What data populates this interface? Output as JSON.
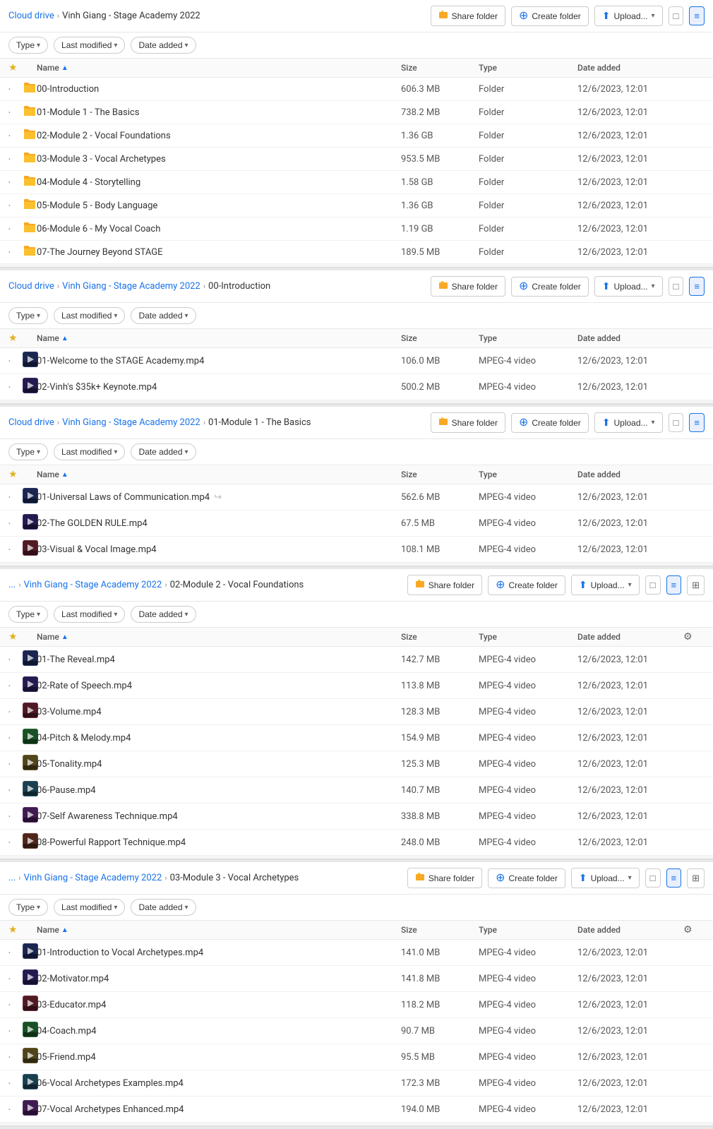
{
  "colors": {
    "accent": "#1a73e8",
    "folder": "#f9a825",
    "text_muted": "#555",
    "border": "#e0e0e0"
  },
  "sections": [
    {
      "id": "section1",
      "breadcrumb": [
        "Cloud drive",
        "Vinh Giang - Stage Academy 2022"
      ],
      "toolbar": {
        "share_label": "Share folder",
        "create_label": "Create folder",
        "upload_label": "Upload...",
        "view_list": true,
        "view_grid": false
      },
      "filters": [
        "Type",
        "Last modified",
        "Date added"
      ],
      "columns": [
        "Name",
        "Size",
        "Type",
        "Date added"
      ],
      "rows": [
        {
          "dot": "•",
          "name": "00-Introduction",
          "size": "606.3 MB",
          "type": "Folder",
          "date": "12/6/2023, 12:01",
          "icon": "folder"
        },
        {
          "dot": "•",
          "name": "01-Module 1 - The Basics",
          "size": "738.2 MB",
          "type": "Folder",
          "date": "12/6/2023, 12:01",
          "icon": "folder"
        },
        {
          "dot": "•",
          "name": "02-Module 2 - Vocal Foundations",
          "size": "1.36 GB",
          "type": "Folder",
          "date": "12/6/2023, 12:01",
          "icon": "folder"
        },
        {
          "dot": "•",
          "name": "03-Module 3 - Vocal Archetypes",
          "size": "953.5 MB",
          "type": "Folder",
          "date": "12/6/2023, 12:01",
          "icon": "folder"
        },
        {
          "dot": "•",
          "name": "04-Module 4 - Storytelling",
          "size": "1.58 GB",
          "type": "Folder",
          "date": "12/6/2023, 12:01",
          "icon": "folder"
        },
        {
          "dot": "•",
          "name": "05-Module 5 - Body Language",
          "size": "1.36 GB",
          "type": "Folder",
          "date": "12/6/2023, 12:01",
          "icon": "folder"
        },
        {
          "dot": "•",
          "name": "06-Module 6 - My Vocal Coach",
          "size": "1.19 GB",
          "type": "Folder",
          "date": "12/6/2023, 12:01",
          "icon": "folder"
        },
        {
          "dot": "•",
          "name": "07-The Journey Beyond STAGE",
          "size": "189.5 MB",
          "type": "Folder",
          "date": "12/6/2023, 12:01",
          "icon": "folder"
        }
      ]
    },
    {
      "id": "section2",
      "breadcrumb": [
        "Cloud drive",
        "Vinh Giang - Stage Academy 2022",
        "00-Introduction"
      ],
      "toolbar": {
        "share_label": "Share folder",
        "create_label": "Create folder",
        "upload_label": "Upload...",
        "view_list": true,
        "view_grid": false
      },
      "filters": [
        "Type",
        "Last modified",
        "Date added"
      ],
      "columns": [
        "Name",
        "Size",
        "Type",
        "Date added"
      ],
      "rows": [
        {
          "dot": "•",
          "name": "01-Welcome to the STAGE Academy.mp4",
          "size": "106.0 MB",
          "type": "MPEG-4 video",
          "date": "12/6/2023, 12:01",
          "icon": "mp4"
        },
        {
          "dot": "•",
          "name": "02-Vinh's $35k+ Keynote.mp4",
          "size": "500.2 MB",
          "type": "MPEG-4 video",
          "date": "12/6/2023, 12:01",
          "icon": "mp4"
        }
      ]
    },
    {
      "id": "section3",
      "breadcrumb": [
        "Cloud drive",
        "Vinh Giang - Stage Academy 2022",
        "01-Module 1 - The Basics"
      ],
      "toolbar": {
        "share_label": "Share folder",
        "create_label": "Create folder",
        "upload_label": "Upload...",
        "view_list": true,
        "view_grid": false
      },
      "filters": [
        "Type",
        "Last modified",
        "Date added"
      ],
      "columns": [
        "Name",
        "Size",
        "Type",
        "Date added"
      ],
      "rows": [
        {
          "dot": "•",
          "name": "01-Universal Laws of Communication.mp4",
          "size": "562.6 MB",
          "type": "MPEG-4 video",
          "date": "12/6/2023, 12:01",
          "icon": "mp4",
          "has_link": true
        },
        {
          "dot": "•",
          "name": "02-The GOLDEN RULE.mp4",
          "size": "67.5 MB",
          "type": "MPEG-4 video",
          "date": "12/6/2023, 12:01",
          "icon": "mp4"
        },
        {
          "dot": "•",
          "name": "03-Visual & Vocal Image.mp4",
          "size": "108.1 MB",
          "type": "MPEG-4 video",
          "date": "12/6/2023, 12:01",
          "icon": "mp4"
        }
      ]
    },
    {
      "id": "section4",
      "breadcrumb": [
        "...",
        "Vinh Giang - Stage Academy 2022",
        "02-Module 2 - Vocal Foundations"
      ],
      "toolbar": {
        "share_label": "Share folder",
        "create_label": "Create folder",
        "upload_label": "Upload...",
        "view_list": true,
        "view_grid": true
      },
      "filters": [
        "Type",
        "Last modified",
        "Date added"
      ],
      "columns": [
        "Name",
        "Size",
        "Type",
        "Date added"
      ],
      "has_gear": true,
      "rows": [
        {
          "dot": "•",
          "name": "01-The Reveal.mp4",
          "size": "142.7 MB",
          "type": "MPEG-4 video",
          "date": "12/6/2023, 12:01",
          "icon": "mp4"
        },
        {
          "dot": "•",
          "name": "02-Rate of Speech.mp4",
          "size": "113.8 MB",
          "type": "MPEG-4 video",
          "date": "12/6/2023, 12:01",
          "icon": "mp4"
        },
        {
          "dot": "•",
          "name": "03-Volume.mp4",
          "size": "128.3 MB",
          "type": "MPEG-4 video",
          "date": "12/6/2023, 12:01",
          "icon": "mp4"
        },
        {
          "dot": "•",
          "name": "04-Pitch & Melody.mp4",
          "size": "154.9 MB",
          "type": "MPEG-4 video",
          "date": "12/6/2023, 12:01",
          "icon": "mp4"
        },
        {
          "dot": "•",
          "name": "05-Tonality.mp4",
          "size": "125.3 MB",
          "type": "MPEG-4 video",
          "date": "12/6/2023, 12:01",
          "icon": "mp4"
        },
        {
          "dot": "•",
          "name": "06-Pause.mp4",
          "size": "140.7 MB",
          "type": "MPEG-4 video",
          "date": "12/6/2023, 12:01",
          "icon": "mp4"
        },
        {
          "dot": "•",
          "name": "07-Self Awareness Technique.mp4",
          "size": "338.8 MB",
          "type": "MPEG-4 video",
          "date": "12/6/2023, 12:01",
          "icon": "mp4"
        },
        {
          "dot": "•",
          "name": "08-Powerful Rapport Technique.mp4",
          "size": "248.0 MB",
          "type": "MPEG-4 video",
          "date": "12/6/2023, 12:01",
          "icon": "mp4"
        }
      ]
    },
    {
      "id": "section5",
      "breadcrumb": [
        "...",
        "Vinh Giang - Stage Academy 2022",
        "03-Module 3 - Vocal Archetypes"
      ],
      "toolbar": {
        "share_label": "Share folder",
        "create_label": "Create folder",
        "upload_label": "Upload...",
        "view_list": true,
        "view_grid": true
      },
      "filters": [
        "Type",
        "Last modified",
        "Date added"
      ],
      "columns": [
        "Name",
        "Size",
        "Type",
        "Date added"
      ],
      "has_gear": true,
      "rows": [
        {
          "dot": "•",
          "name": "01-Introduction to Vocal Archetypes.mp4",
          "size": "141.0 MB",
          "type": "MPEG-4 video",
          "date": "12/6/2023, 12:01",
          "icon": "mp4"
        },
        {
          "dot": "•",
          "name": "02-Motivator.mp4",
          "size": "141.8 MB",
          "type": "MPEG-4 video",
          "date": "12/6/2023, 12:01",
          "icon": "mp4"
        },
        {
          "dot": "•",
          "name": "03-Educator.mp4",
          "size": "118.2 MB",
          "type": "MPEG-4 video",
          "date": "12/6/2023, 12:01",
          "icon": "mp4"
        },
        {
          "dot": "•",
          "name": "04-Coach.mp4",
          "size": "90.7 MB",
          "type": "MPEG-4 video",
          "date": "12/6/2023, 12:01",
          "icon": "mp4"
        },
        {
          "dot": "•",
          "name": "05-Friend.mp4",
          "size": "95.5 MB",
          "type": "MPEG-4 video",
          "date": "12/6/2023, 12:01",
          "icon": "mp4"
        },
        {
          "dot": "•",
          "name": "06-Vocal Archetypes Examples.mp4",
          "size": "172.3 MB",
          "type": "MPEG-4 video",
          "date": "12/6/2023, 12:01",
          "icon": "mp4"
        },
        {
          "dot": "•",
          "name": "07-Vocal Archetypes Enhanced.mp4",
          "size": "194.0 MB",
          "type": "MPEG-4 video",
          "date": "12/6/2023, 12:01",
          "icon": "mp4"
        }
      ]
    }
  ]
}
